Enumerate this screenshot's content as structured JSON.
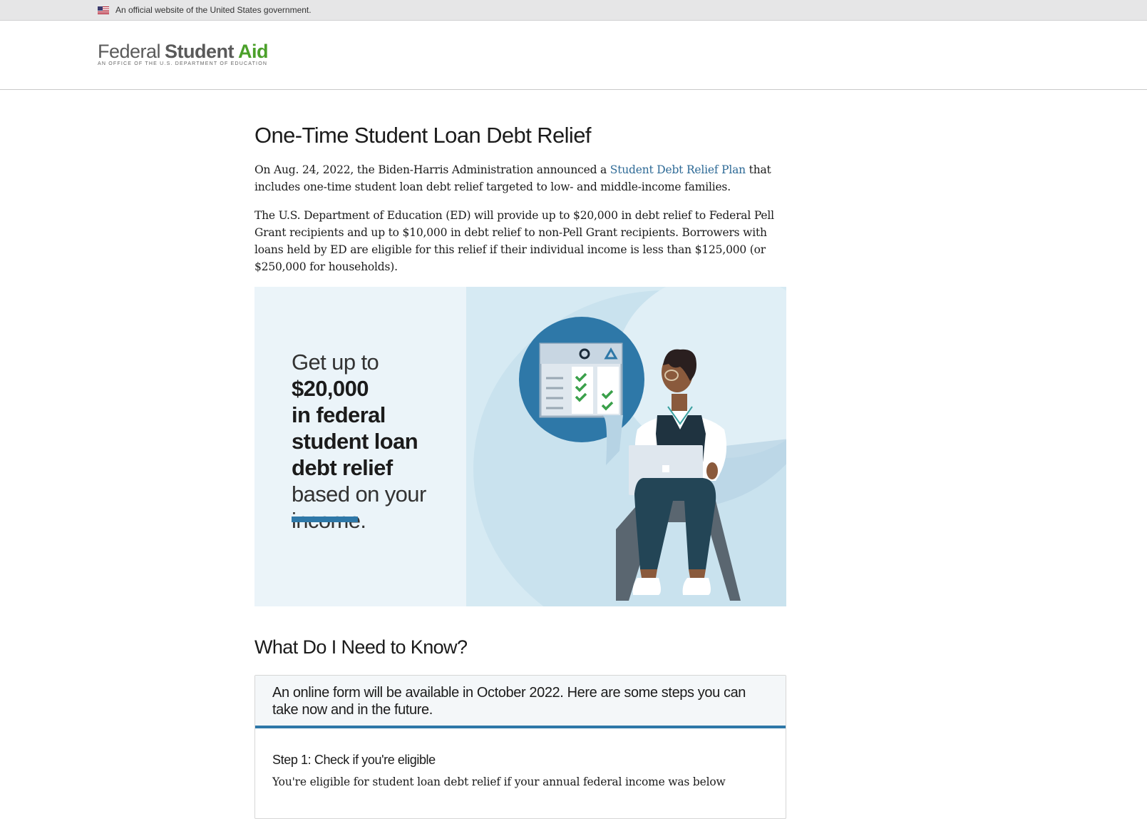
{
  "gov_banner": {
    "text": "An official website of the United States government."
  },
  "logo": {
    "federal": "Federal",
    "student": "Student",
    "aid": "Aid",
    "subtitle": "An OFFICE of the U.S. DEPARTMENT of EDUCATION"
  },
  "colors": {
    "brand_green": "#4ba02a",
    "link_blue": "#2e6a96",
    "accent_blue": "#2e78a8"
  },
  "page": {
    "title": "One-Time Student Loan Debt Relief",
    "intro": {
      "before_link": "On Aug. 24, 2022, the Biden-Harris Administration announced a ",
      "link": "Student Debt Relief Plan",
      "after_link": " that includes one-time student loan debt relief targeted to low- and middle-income families."
    },
    "paragraph2": "The U.S. Department of Education (ED) will provide up to $20,000 in debt relief to Federal Pell Grant recipients and up to $10,000 in debt relief to non-Pell Grant recipients. Borrowers with loans held by ED are eligible for this relief if their individual income is less than $125,000 (or $250,000 for households)."
  },
  "hero": {
    "line_prefix": "Get up to ",
    "amount": "$20,000",
    "bold_rest": "in federal student loan debt relief",
    "suffix": "based on your income."
  },
  "section": {
    "title": "What Do I Need to Know?",
    "card_heading": "An online form will be available in October 2022. Here are some steps you can take now and in the future.",
    "step1_title": "Step 1: Check if you're eligible",
    "step1_text": "You're eligible for student loan debt relief if your annual federal income was below"
  }
}
